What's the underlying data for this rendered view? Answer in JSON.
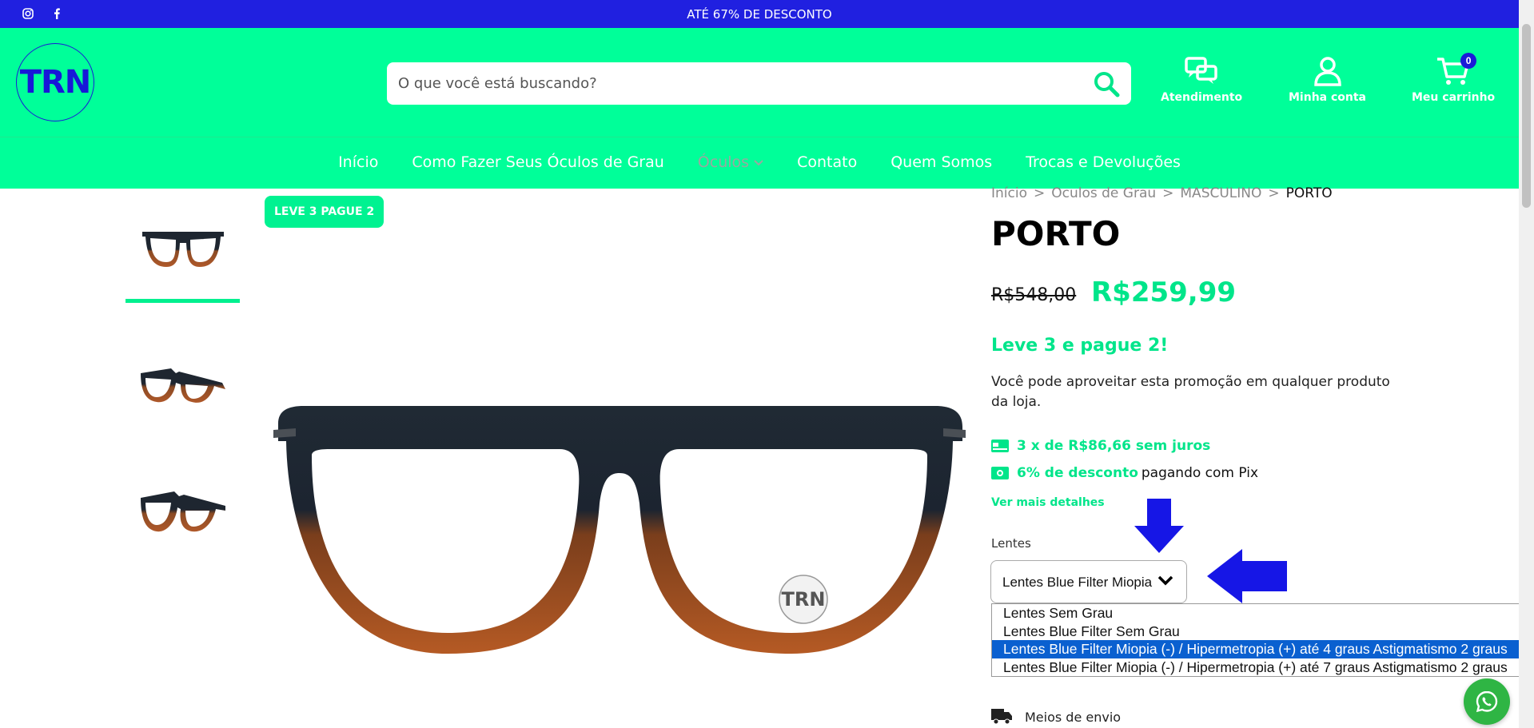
{
  "topbar": {
    "promo_text": "ATÉ 67% DE DESCONTO",
    "social": [
      "instagram-icon",
      "facebook-icon"
    ],
    "background": "#2020e0"
  },
  "header": {
    "logo_text": "TRN",
    "search_placeholder": "O que você está buscando?",
    "links": {
      "support": "Atendimento",
      "account": "Minha conta",
      "cart": "Meu carrinho",
      "cart_count": "0"
    },
    "background": "#00ff99"
  },
  "nav": {
    "items": [
      "Início",
      "Como Fazer Seus Óculos de Grau",
      "Óculos",
      "Contato",
      "Quem Somos",
      "Trocas e Devoluções"
    ]
  },
  "gallery": {
    "badge": "LEVE 3 PAGUE 2",
    "watermark": "TRN"
  },
  "product": {
    "breadcrumb": [
      "Início",
      "Oculos de Grau",
      "MASCULINO",
      "PORTO"
    ],
    "title": "PORTO",
    "old_price": "R$548,00",
    "price": "R$259,99",
    "promo_title": "Leve 3 e pague 2!",
    "promo_desc": "Você pode aproveitar esta promoção em qualquer produto da loja.",
    "installments": "3 x de R$86,66 sem juros",
    "pix_highlight": "6% de desconto",
    "pix_rest": "pagando com Pix",
    "more_details": "Ver mais detalhes",
    "lens_label": "Lentes",
    "lens_selected": "Lentes Blue Filter Miopia (-) / Hipermetropia (+) até 4 graus Astigmatismo 2 graus",
    "lens_options": [
      "Lentes Sem Grau",
      "Lentes Blue Filter Sem Grau",
      "Lentes Blue Filter Miopia (-) / Hipermetropia (+) até 4 graus Astigmatismo 2 graus",
      "Lentes Blue Filter Miopia (-) / Hipermetropia (+) até 7 graus Astigmatismo 2 graus"
    ],
    "selected_index": 2,
    "shipping_label": "Meios de envio",
    "accent": "#00e58a"
  }
}
